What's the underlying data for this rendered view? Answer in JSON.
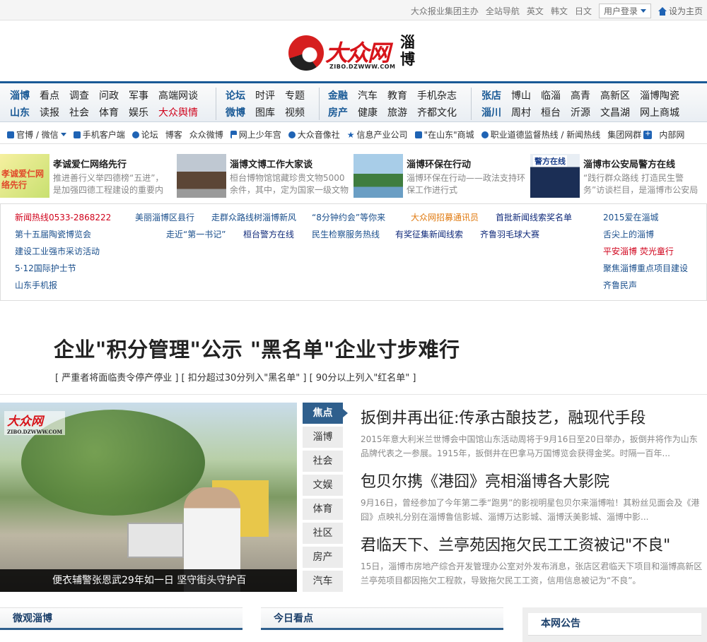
{
  "topbar": {
    "host": "大众报业集团主办",
    "sitenav": "全站导航",
    "english": "英文",
    "korean": "韩文",
    "japanese": "日文",
    "login": "用户登录",
    "sethome": "设为主页"
  },
  "logo": {
    "name": "大众网",
    "url": "ZIBO.DZWWW.COM",
    "city": "淄博"
  },
  "nav": {
    "g1": {
      "row1": [
        "淄博",
        "看点",
        "调查",
        "问政",
        "军事",
        "高端网谈"
      ],
      "row2": [
        "山东",
        "读报",
        "社会",
        "体育",
        "娱乐",
        "大众舆情"
      ]
    },
    "g2": {
      "row1": [
        "论坛",
        "时评",
        "专题"
      ],
      "row2": [
        "微博",
        "图库",
        "视频"
      ]
    },
    "g3": {
      "row1": [
        "金融",
        "汽车",
        "教育",
        "手机杂志"
      ],
      "row2": [
        "房产",
        "健康",
        "旅游",
        "齐都文化"
      ]
    },
    "g4": {
      "row1": [
        "张店",
        "博山",
        "临淄",
        "高青",
        "高新区",
        "淄博陶瓷"
      ],
      "row2": [
        "淄川",
        "周村",
        "桓台",
        "沂源",
        "文昌湖",
        "网上商城"
      ]
    }
  },
  "subnav": {
    "wechat": "官博 / 微信",
    "mobile": "手机客户端",
    "forum": "论坛",
    "blog": "博客",
    "weibo": "众众微博",
    "youth": "网上少年宫",
    "sound": "大众音像社",
    "info": "信息产业公司",
    "mall": "\"在山东\"商城",
    "hotline": "职业道德监督热线 / 新闻热线",
    "group": "集团网群",
    "intranet": "内部网"
  },
  "features": [
    {
      "title": "孝诚爱仁网络先行",
      "desc": "推进善行义举四德榜“五进”，是加强四德工程建设的重要内",
      "thumb": "孝诚爱仁网络先行"
    },
    {
      "title": "淄博文博工作大家谈",
      "desc": "桓台博物馆馆藏珍贵文物5000余件，其中，定为国家一级文物的"
    },
    {
      "title": "淄博环保在行动",
      "desc": "淄博环保在行动——政法支持环保工作进行式"
    },
    {
      "title": "淄博市公安局警方在线",
      "desc": "“践行群众路线 打造民生警务”访谈栏目，是淄博市公安局",
      "thumb": "警方在线"
    }
  ],
  "links": {
    "hotline": "新闻热线0533-2868222",
    "l1": "第十五届陶瓷博览会",
    "l2": "建设工业强市采访活动",
    "l3": "5·12国际护士节",
    "l4": "山东手机报",
    "l5": "美丽淄博区县行",
    "l6": "走群众路线树淄博新风",
    "l7": "“8分钟约会”等你来",
    "l8": "大众网招募通讯员",
    "l9": "首批新闻线索奖名单",
    "l10": "走近“第一书记”",
    "l11": "桓台警方在线",
    "l12": "民生检察服务热线",
    "l13": "有奖征集新闻线索",
    "l14": "齐鲁羽毛球大赛",
    "l15": "2015爱在淄城",
    "l16": "舌尖上的淄博",
    "l17": "平安淄博 荧光童行",
    "l18": "聚焦淄博重点项目建设",
    "l19": "齐鲁民声"
  },
  "headline": {
    "title": "企业\"积分管理\"公示 \"黑名单\"企业寸步难行",
    "sub": "[ 严重者将面临责令停产停业 ] [ 扣分超过30分列入\"黑名单\" ] [ 90分以上列入\"红名单\" ]"
  },
  "photo": {
    "caption": "便衣辅警张恩武29年如一日 坚守街头守护百",
    "logo": "大众网",
    "logo_sub": "ZIBO.DZWWW.COM"
  },
  "tabs": [
    "焦点",
    "淄博",
    "社会",
    "文娱",
    "体育",
    "社区",
    "房产",
    "汽车"
  ],
  "news": [
    {
      "title": "扳倒井再出征:传承古酿技艺，融现代手段",
      "desc": "2015年意大利米兰世博会中国馆山东活动周将于9月16日至20日举办，扳倒井将作为山东品牌代表之一参展。1915年，扳倒井在巴拿马万国博览会获得金奖。时隔一百年..."
    },
    {
      "title": "包贝尔携《港囧》亮相淄博各大影院",
      "desc": "9月16日，曾经参加了今年第二季“跑男”的影视明星包贝尔来淄博啦！其粉丝见面会及《港囧》点映礼分别在淄博鲁信影城、淄博万达影城、淄博沃美影城、淄博中影..."
    },
    {
      "title": "君临天下、兰亭苑因拖欠民工工资被记\"不良\"",
      "desc": "15日，淄博市房地产综合开发管理办公室对外发布消息，张店区君临天下项目和淄博高新区兰亭苑项目都因拖欠工程款，导致拖欠民工工资，信用信息被记为“不良”。"
    }
  ],
  "panels": {
    "weiguan": "微观淄博",
    "today": "今日看点",
    "notice": "本网公告"
  }
}
